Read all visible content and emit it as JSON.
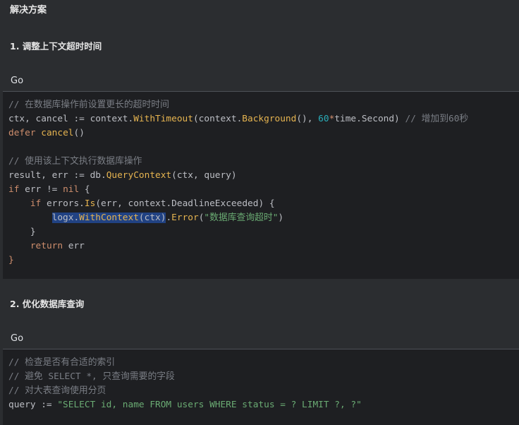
{
  "section_title": "解决方案",
  "steps": [
    {
      "heading": "1. 调整上下文超时时间",
      "language": "Go",
      "lines": [
        "// 在数据库操作前设置更长的超时时间",
        "ctx, cancel := context.WithTimeout(context.Background(), 60*time.Second) // 增加到60秒",
        "defer cancel()",
        "",
        "// 使用该上下文执行数据库操作",
        "result, err := db.QueryContext(ctx, query)",
        "if err != nil {",
        "    if errors.Is(err, context.DeadlineExceeded) {",
        "        logx.WithContext(ctx).Error(\"数据库查询超时\")",
        "    }",
        "    return err",
        "}"
      ]
    },
    {
      "heading": "2. 优化数据库查询",
      "language": "Go",
      "lines": [
        "// 检查是否有合适的索引",
        "// 避免 SELECT *, 只查询需要的字段",
        "// 对大表查询使用分页",
        "query := \"SELECT id, name FROM users WHERE status = ? LIMIT ?, ?\""
      ]
    }
  ]
}
